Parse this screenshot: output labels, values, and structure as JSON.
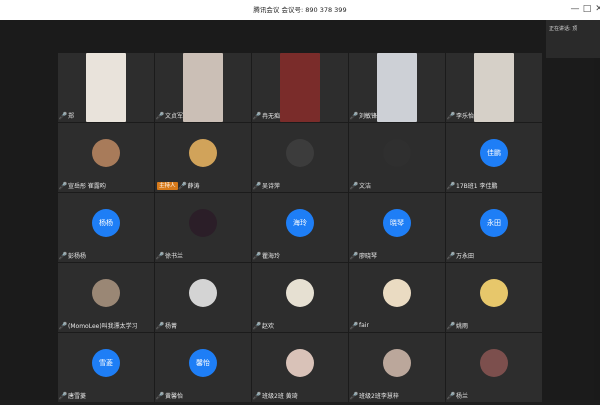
{
  "window": {
    "title": "腾讯会议 会议号: 890 378 399",
    "controls": [
      "—",
      "□",
      "✕"
    ]
  },
  "sidebar_status": "正在讲话: 顶",
  "participants": [
    {
      "name": "郑",
      "type": "video",
      "bg": "#e9e3db"
    },
    {
      "name": "文贞军",
      "type": "video",
      "bg": "#cbbfb6"
    },
    {
      "name": "冉无痴",
      "type": "video",
      "bg": "#7a2c2a"
    },
    {
      "name": "刘敏锋",
      "type": "video",
      "bg": "#cdd0d6"
    },
    {
      "name": "李乐怡",
      "type": "video",
      "bg": "#d6d0c8"
    },
    {
      "name": "宣岳彤 崔露昀",
      "type": "photo",
      "bg": "#a87b5a"
    },
    {
      "name": "薛涛",
      "type": "photo",
      "bg": "#d1a35a",
      "host": true
    },
    {
      "name": "吴诗萍",
      "type": "photo",
      "bg": "#3c3c3c"
    },
    {
      "name": "文洁",
      "type": "photo",
      "bg": "#2f2f2f"
    },
    {
      "name": "17B班1 李佳鹏",
      "type": "text",
      "avatar": "佳鹏"
    },
    {
      "name": "彭杨杨",
      "type": "text",
      "avatar": "杨杨"
    },
    {
      "name": "徐书兰",
      "type": "photo",
      "bg": "#2b1e28"
    },
    {
      "name": "瞿海玲",
      "type": "text",
      "avatar": "海玲"
    },
    {
      "name": "廖晓琴",
      "type": "text",
      "avatar": "晓琴"
    },
    {
      "name": "万永田",
      "type": "text",
      "avatar": "永田"
    },
    {
      "name": "(MomoLee)叫我漂太学习",
      "type": "photo",
      "bg": "#9a8775"
    },
    {
      "name": "杨菁",
      "type": "photo",
      "bg": "#d4d4d4"
    },
    {
      "name": "赵欢",
      "type": "photo",
      "bg": "#e6e0d2"
    },
    {
      "name": "fair",
      "type": "photo",
      "bg": "#eadbc2"
    },
    {
      "name": "姚雨",
      "type": "photo",
      "bg": "#e7c76b"
    },
    {
      "name": "唐雪菱",
      "type": "text",
      "avatar": "雪菱"
    },
    {
      "name": "黄馨怡",
      "type": "text",
      "avatar": "馨怡"
    },
    {
      "name": "班级2班 黄琦",
      "type": "photo",
      "bg": "#d9c2b8"
    },
    {
      "name": "班级2班李慧梓",
      "type": "photo",
      "bg": "#bba79b"
    },
    {
      "name": "杨兰",
      "type": "photo",
      "bg": "#7c4f4d"
    }
  ],
  "host_badge": "主持人"
}
